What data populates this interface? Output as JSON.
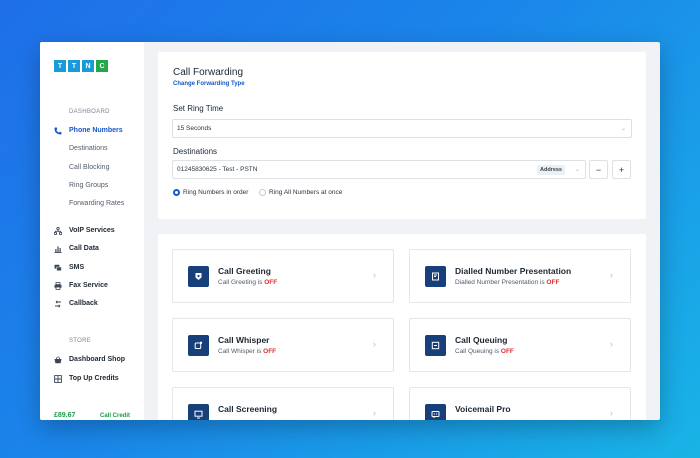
{
  "brand": {
    "logo_letters": [
      "T",
      "T",
      "N",
      "C"
    ],
    "logo_colors": [
      "#1a9bd7",
      "#1a9bd7",
      "#1a9bd7",
      "#21a84a"
    ]
  },
  "sidebar": {
    "dashboard_label": "DASHBOARD",
    "phone_numbers": {
      "label": "Phone Numbers",
      "icon": "phone-icon"
    },
    "sub_items": [
      "Destinations",
      "Call Blocking",
      "Ring Groups",
      "Forwarding Rates"
    ],
    "items": [
      {
        "label": "VoIP Services",
        "icon": "network-icon"
      },
      {
        "label": "Call Data",
        "icon": "bar-chart-icon"
      },
      {
        "label": "SMS",
        "icon": "chat-icon"
      },
      {
        "label": "Fax Service",
        "icon": "printer-icon"
      },
      {
        "label": "Callback",
        "icon": "callback-icon"
      }
    ],
    "store_label": "STORE",
    "store_items": [
      {
        "label": "Dashboard Shop",
        "icon": "basket-icon"
      },
      {
        "label": "Top Up Credits",
        "icon": "grid-icon"
      }
    ],
    "credit_value": "£89.67",
    "credit_label": "Call Credit"
  },
  "forwarding": {
    "title": "Call Forwarding",
    "change_link": "Change Forwarding Type",
    "ring_time_label": "Set Ring Time",
    "ring_time_value": "15 Seconds",
    "destinations_label": "Destinations",
    "destination_value": "01245830625 - Test - PSTN",
    "destination_badge": "Address",
    "minus_label": "−",
    "plus_label": "+",
    "radio_options": [
      {
        "label": "Ring Numbers in order",
        "selected": true
      },
      {
        "label": "Ring All Numbers at once",
        "selected": false
      }
    ]
  },
  "features": [
    {
      "name": "Call Greeting",
      "status_prefix": "Call Greeting is",
      "status": "OFF",
      "icon": "greeting-icon"
    },
    {
      "name": "Dialled Number Presentation",
      "status_prefix": "Dialled Number Presentation is",
      "status": "OFF",
      "icon": "presentation-icon"
    },
    {
      "name": "Call Whisper",
      "status_prefix": "Call Whisper is",
      "status": "OFF",
      "icon": "whisper-icon"
    },
    {
      "name": "Call Queuing",
      "status_prefix": "Call Queuing is",
      "status": "OFF",
      "icon": "queue-icon"
    },
    {
      "name": "Call Screening",
      "status_prefix": "",
      "status": "",
      "icon": "screening-icon"
    },
    {
      "name": "Voicemail Pro",
      "status_prefix": "",
      "status": "",
      "icon": "voicemail-icon"
    }
  ],
  "colors": {
    "accent": "#1458c9",
    "off": "#e0292f",
    "credit": "#1a9b4a",
    "feature_icon_bg": "#173f7a"
  }
}
